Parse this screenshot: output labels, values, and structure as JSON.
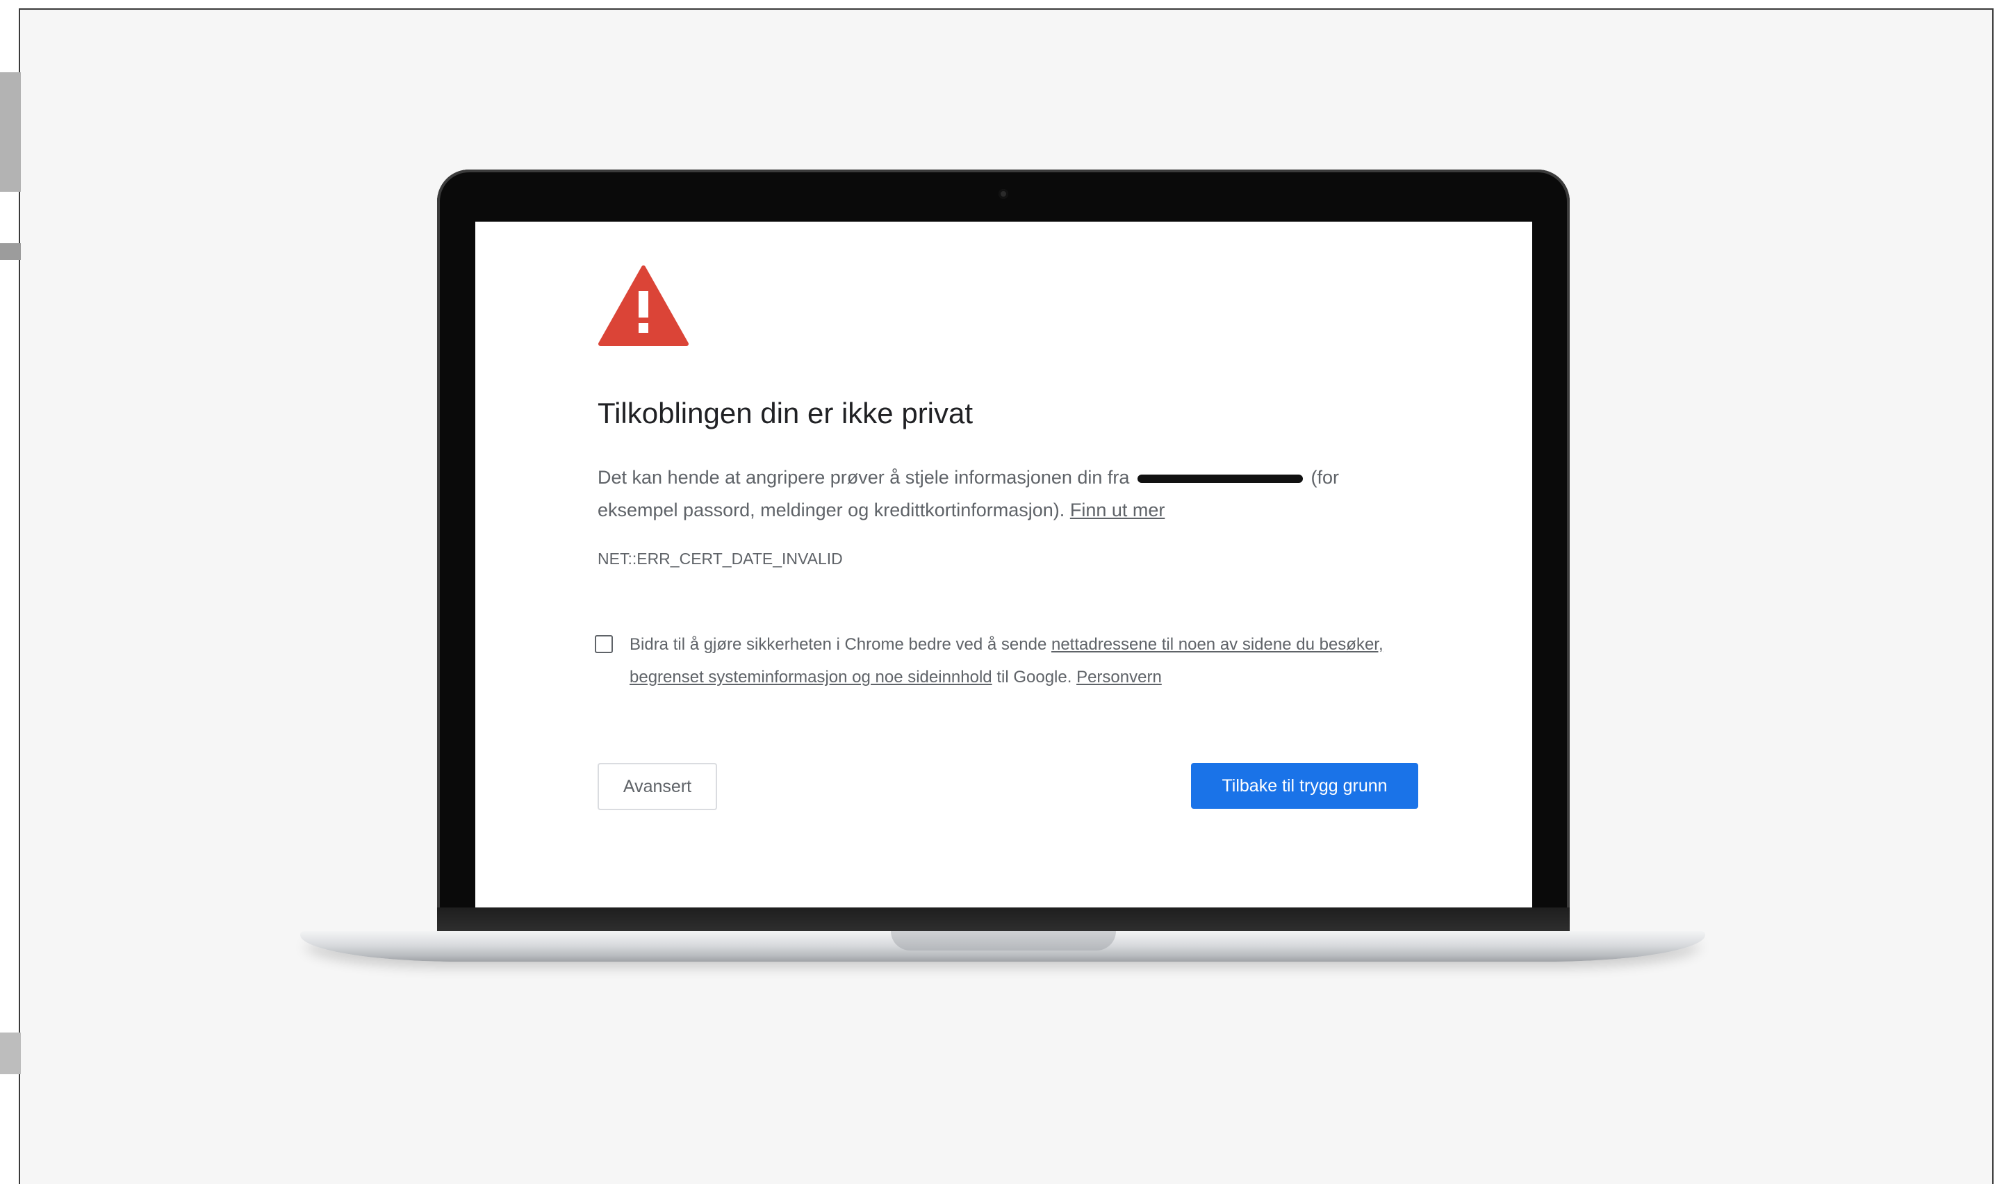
{
  "page": {
    "title": "Tilkoblingen din er ikke privat",
    "description_before": "Det kan hende at angripere prøver å stjele informasjonen din fra",
    "description_after": "(for eksempel passord, meldinger og kredittkortinformasjon).",
    "learn_more_link": "Finn ut mer",
    "error_code": "NET::ERR_CERT_DATE_INVALID",
    "optin": {
      "text_before": "Bidra til å gjøre sikkerheten i Chrome bedre ved å sende",
      "link_urls": "nettadressene til noen av sidene du besøker, begrenset systeminformasjon og noe sideinnhold",
      "text_after": "til Google.",
      "link_privacy": "Personvern",
      "checked": false
    },
    "buttons": {
      "advanced": "Avansert",
      "back_to_safety": "Tilbake til trygg grunn"
    }
  },
  "colors": {
    "warning_red": "#db4437",
    "primary_blue": "#1a73e8",
    "text_primary": "#202124",
    "text_secondary": "#5f6368"
  },
  "icons": {
    "warning": "warning-triangle-icon",
    "camera": "camera-icon"
  }
}
